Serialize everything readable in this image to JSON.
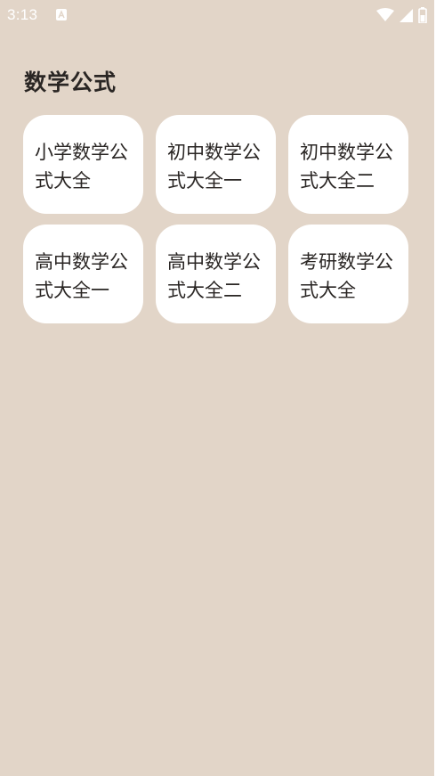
{
  "status_bar": {
    "time": "3:13",
    "notification_icon": "text-a-icon",
    "icons": [
      "wifi-icon",
      "signal-icon",
      "battery-icon"
    ]
  },
  "page": {
    "title": "数学公式"
  },
  "cards": [
    {
      "label": "小学数学公式大全"
    },
    {
      "label": "初中数学公式大全一"
    },
    {
      "label": "初中数学公式大全二"
    },
    {
      "label": "高中数学公式大全一"
    },
    {
      "label": "高中数学公式大全二"
    },
    {
      "label": "考研数学公式大全"
    }
  ],
  "colors": {
    "background": "#e2d5c8",
    "card": "#ffffff",
    "text": "#2a2624",
    "status_icons": "#ffffff"
  }
}
